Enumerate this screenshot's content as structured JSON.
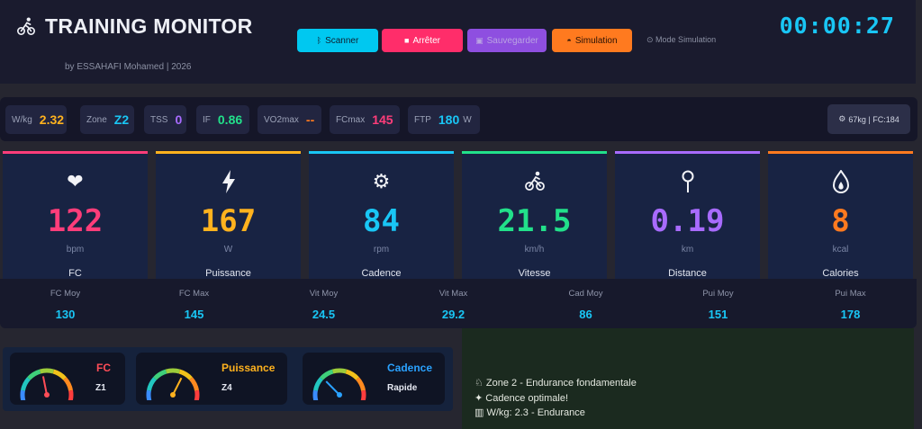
{
  "header": {
    "title": "TRAINING MONITOR",
    "byline": "by ESSAHAFI Mohamed | 2026",
    "timer": "00:00:27",
    "buttons": {
      "scan": "Scanner",
      "stop": "Arrêter",
      "save": "Sauvegarder",
      "simulate": "Simulation"
    },
    "sim_mode_label": "Mode Simulation"
  },
  "stats": {
    "wkg": {
      "label": "W/kg",
      "value": "2.32",
      "color": "#ffb21e"
    },
    "zone": {
      "label": "Zone",
      "value": "Z2",
      "color": "#19c6f5"
    },
    "tss": {
      "label": "TSS",
      "value": "0",
      "color": "#a86bff"
    },
    "if": {
      "label": "IF",
      "value": "0.86",
      "color": "#22e08a"
    },
    "vo2max": {
      "label": "VO2max",
      "value": "--",
      "color": "#ff7a1f"
    },
    "fcmax": {
      "label": "FCmax",
      "value": "145",
      "color": "#ff3d7a"
    },
    "ftp": {
      "label": "FTP",
      "value": "180",
      "unit": "W",
      "color": "#19c6f5"
    },
    "user": "67kg | FC:184"
  },
  "cards": [
    {
      "id": "fc",
      "icon": "heart-icon",
      "value": "122",
      "unit": "bpm",
      "name": "FC",
      "color": "#ff3d7a"
    },
    {
      "id": "power",
      "icon": "lightning-icon",
      "value": "167",
      "unit": "W",
      "name": "Puissance",
      "color": "#ffb21e"
    },
    {
      "id": "cadence",
      "icon": "gear-icon",
      "value": "84",
      "unit": "rpm",
      "name": "Cadence",
      "color": "#19c6f5"
    },
    {
      "id": "speed",
      "icon": "cyclist-icon",
      "value": "21.5",
      "unit": "km/h",
      "name": "Vitesse",
      "color": "#22e08a"
    },
    {
      "id": "distance",
      "icon": "pin-icon",
      "value": "0.19",
      "unit": "km",
      "name": "Distance",
      "color": "#a86bff"
    },
    {
      "id": "calories",
      "icon": "flame-icon",
      "value": "8",
      "unit": "kcal",
      "name": "Calories",
      "color": "#ff7a1f"
    }
  ],
  "summary": [
    {
      "label": "FC Moy",
      "value": "130"
    },
    {
      "label": "FC Max",
      "value": "145"
    },
    {
      "label": "Vit Moy",
      "value": "24.5"
    },
    {
      "label": "Vit Max",
      "value": "29.2"
    },
    {
      "label": "Cad Moy",
      "value": "86"
    },
    {
      "label": "Pui Moy",
      "value": "151"
    },
    {
      "label": "Pui Max",
      "value": "178"
    }
  ],
  "gauges": [
    {
      "name": "FC",
      "sub": "Z1",
      "color": "#ff4d57",
      "level": 0.45
    },
    {
      "name": "Puissance",
      "sub": "Z4",
      "color": "#ffb21e",
      "level": 0.62
    },
    {
      "name": "Cadence",
      "sub": "Rapide",
      "color": "#2aa2ff",
      "level": 0.3
    }
  ],
  "advice": [
    {
      "icon": "cyclist-icon",
      "text": "Zone 2 - Endurance fondamentale"
    },
    {
      "icon": "sparkle-icon",
      "text": "Cadence optimale!"
    },
    {
      "icon": "bar-chart-icon",
      "text": "W/kg: 2.3 - Endurance"
    }
  ]
}
